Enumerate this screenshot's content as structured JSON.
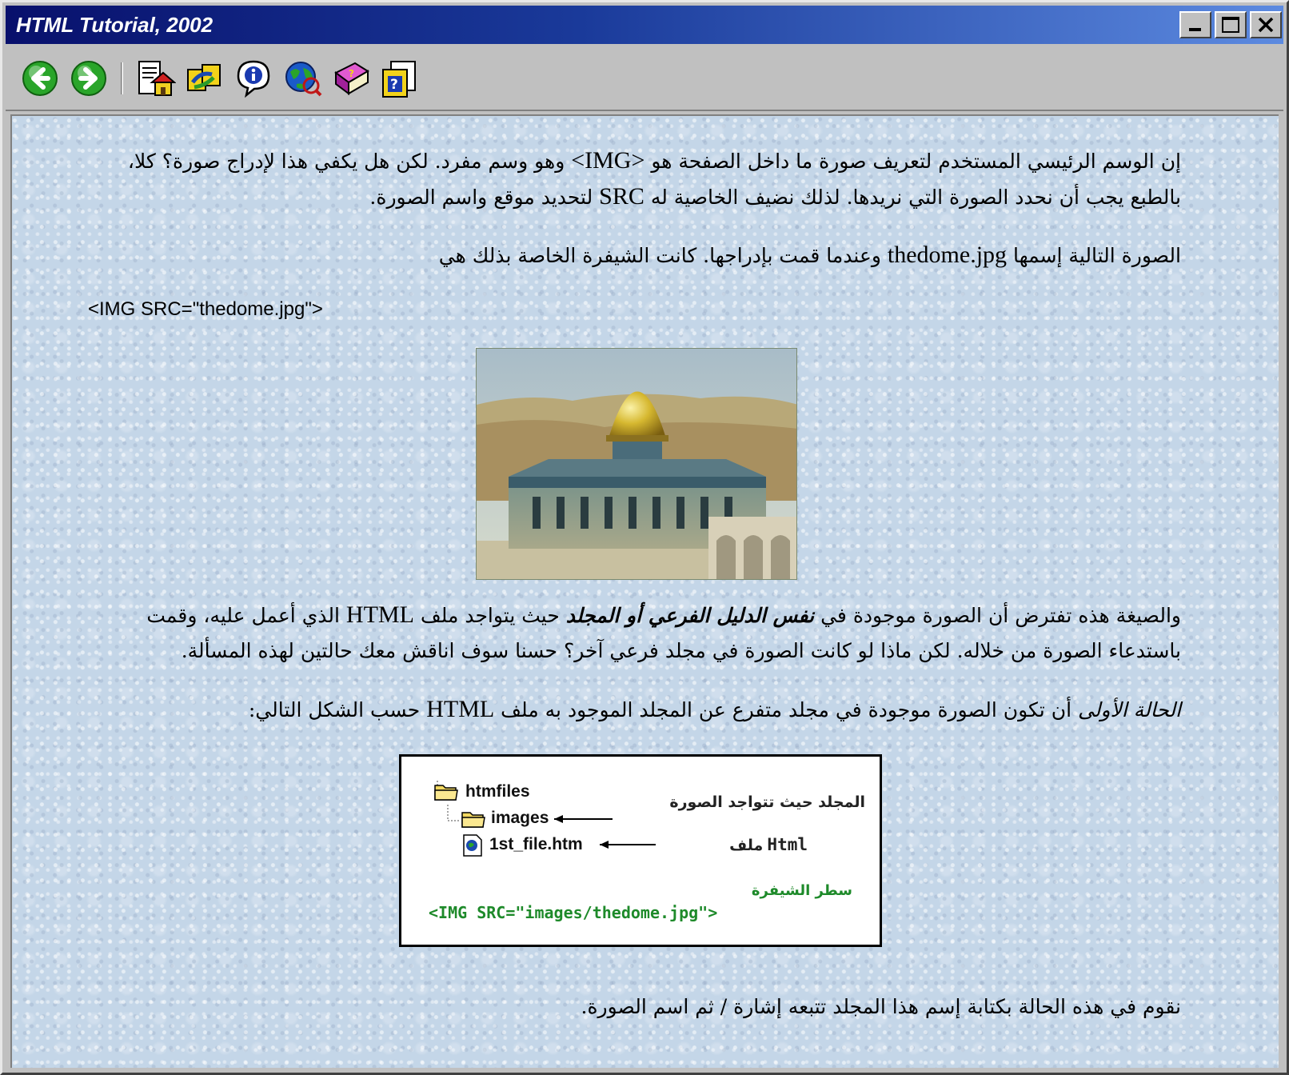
{
  "window": {
    "title": "HTML Tutorial, 2002",
    "controls": [
      "minimize",
      "maximize",
      "close"
    ]
  },
  "toolbar": {
    "buttons": [
      {
        "icon": "back-arrow-icon",
        "color": "#2aa52a"
      },
      {
        "icon": "forward-arrow-icon",
        "color": "#2aa52a"
      },
      {
        "icon": "home-page-icon"
      },
      {
        "icon": "links-icon"
      },
      {
        "icon": "info-icon"
      },
      {
        "icon": "web-globe-icon"
      },
      {
        "icon": "book-icon"
      },
      {
        "icon": "help-document-icon"
      }
    ]
  },
  "content": {
    "para1": {
      "line1_a": "إن الوسم الرئيسي المستخدم لتعريف صورة ما داخل الصفحة هو ",
      "line1_tag": "<IMG>",
      "line1_b": " وهو وسم مفرد. لكن هل يكفي هذا لإدراج صورة؟ كلا،",
      "line2_a": "بالطبع يجب أن نحدد الصورة التي نريدها. لذلك نضيف الخاصية له ",
      "line2_src": "SRC",
      "line2_b": " لتحديد موقع واسم الصورة."
    },
    "para2": {
      "text_a": "الصورة التالية إسمها ",
      "filename": "thedome.jpg",
      "text_b": " وعندما قمت بإدراجها. كانت الشيفرة الخاصة بذلك هي"
    },
    "code1": "<IMG SRC=\"thedome.jpg\">",
    "photo_alt": "thedome.jpg",
    "para3": {
      "line1_a": "والصيغة هذه تفترض أن الصورة موجودة في ",
      "line1_bold": "نفس الدليل الفرعي أو المجلد",
      "line1_b": " حيث يتواجد ملف ",
      "line1_html": "HTML",
      "line1_c": " الذي أعمل عليه، وقمت",
      "line2": "باستدعاء الصورة من خلاله. لكن ماذا لو كانت الصورة في مجلد فرعي آخر؟ حسنا سوف اناقش معك حالتين لهذه المسألة."
    },
    "para4": {
      "case_label": "الحالة الأولى",
      "text_a": " أن تكون الصورة موجودة في مجلد متفرع عن المجلد الموجود به ملف ",
      "html": "HTML",
      "text_b": " حسب الشكل التالي:"
    },
    "diagram": {
      "root_folder": "htmfiles",
      "sub_folder": "images",
      "file": "1st_file.htm",
      "folder_note": "المجلد حيث تتواجد الصورة",
      "file_note_ar": "ملف",
      "file_note_lat": "Html",
      "code_label": "سطر الشيفرة",
      "code_line": "<IMG SRC=\"images/thedome.jpg\">"
    },
    "para5": "نقوم في هذه الحالة بكتابة إسم هذا المجلد تتبعه إشارة / ثم اسم الصورة."
  }
}
